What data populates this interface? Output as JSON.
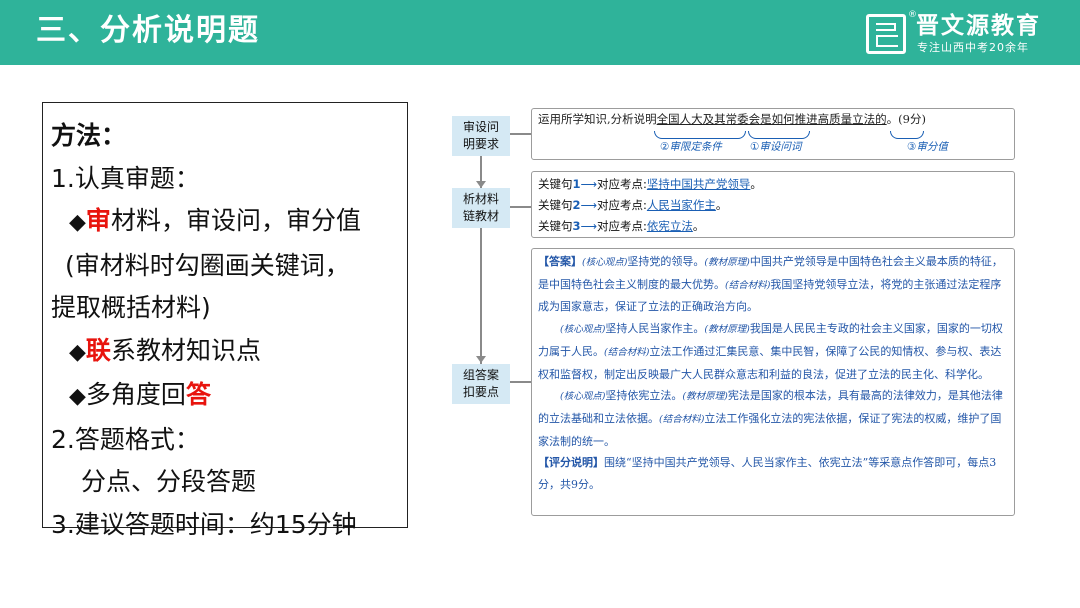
{
  "header": {
    "title": "三、分析说明题",
    "logo_reg": "®",
    "logo_name": "晋文源教育",
    "logo_slogan": "专注山西中考20余年"
  },
  "method": {
    "heading": "方法：",
    "step1": "1.认真审题：",
    "bullet1": {
      "diamond": "◆",
      "red": "审",
      "rest": "材料，审设问，审分值"
    },
    "note_line1": "(审材料时勾圈画关键词，",
    "note_line2": "提取概括材料)",
    "bullet2": {
      "diamond": "◆",
      "red": "联",
      "rest": "系教材知识点"
    },
    "bullet3": {
      "diamond": "◆",
      "text": "多角度回",
      "red": "答"
    },
    "step2": "2.答题格式：",
    "format": "分点、分段答题",
    "step3": "3.建议答题时间：约15分钟"
  },
  "panel": {
    "labels": {
      "l1a": "审设问",
      "l1b": "明要求",
      "l2a": "析材料",
      "l2b": "链教材",
      "l3a": "组答案",
      "l3b": "扣要点"
    },
    "question": {
      "prefix": "运用所学知识,分析说明",
      "underlined": "全国人大及其常委会是如何推进高质量立法的",
      "suffix": "。(9分)",
      "hints": [
        "②审限定条件",
        "①审设问词",
        "③审分值"
      ]
    },
    "key_sentences": [
      {
        "label": "关键句",
        "num": "1",
        "arrow": "⟶",
        "mid": "对应考点:",
        "point": "坚持中国共产党领导",
        "end": "。"
      },
      {
        "label": "关键句",
        "num": "2",
        "arrow": "⟶",
        "mid": "对应考点:",
        "point": "人民当家作主",
        "end": "。"
      },
      {
        "label": "关键句",
        "num": "3",
        "arrow": "⟶",
        "mid": "对应考点:",
        "point": "依宪立法",
        "end": "。"
      }
    ],
    "answer": {
      "p1_tag": "【答案】",
      "p1_t1": "(核心观点)",
      "p1_a": "坚持党的领导。",
      "p1_t2": "(教材原理)",
      "p1_b": "中国共产党领导是中国特色社会主义最本质的特征，是中国特色社会主义制度的最大优势。",
      "p1_t3": "(结合材料)",
      "p1_c": "我国坚持党领导立法，将党的主张通过法定程序成为国家意志，保证了立法的正确政治方向。",
      "p2_t1": "(核心观点)",
      "p2_a": "坚持人民当家作主。",
      "p2_t2": "(教材原理)",
      "p2_b": "我国是人民民主专政的社会主义国家，国家的一切权力属于人民。",
      "p2_t3": "(结合材料)",
      "p2_c": "立法工作通过汇集民意、集中民智，保障了公民的知情权、参与权、表达权和监督权，制定出反映最广大人民群众意志和利益的良法，促进了立法的民主化、科学化。",
      "p3_t1": "(核心观点)",
      "p3_a": "坚持依宪立法。",
      "p3_t2": "(教材原理)",
      "p3_b": "宪法是国家的根本法，具有最高的法律效力，是其他法律的立法基础和立法依据。",
      "p3_t3": "(结合材料)",
      "p3_c": "立法工作强化立法的宪法依据，保证了宪法的权威，维护了国家法制的统一。",
      "p4_tag": "【评分说明】",
      "p4": "围绕“坚持中国共产党领导、人民当家作主、依宪立法”等采意点作答即可，每点3分，共9分。"
    }
  },
  "colors": {
    "header": "#2fb39a",
    "accent_red": "#e8140e",
    "label_bg": "#d5e9f4",
    "answer_blue": "#2457a8"
  }
}
